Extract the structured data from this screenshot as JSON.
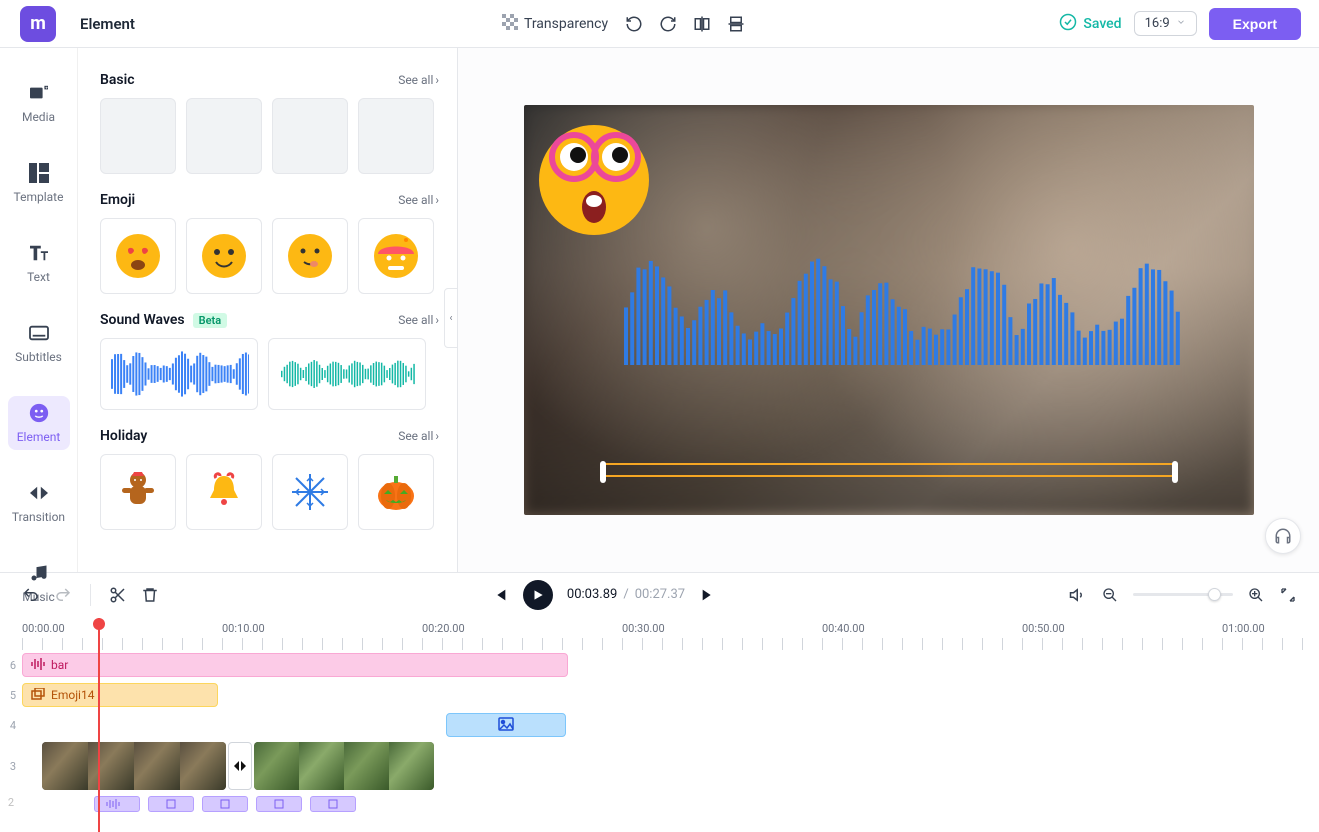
{
  "panel_title": "Element",
  "toolbar": {
    "transparency_label": "Transparency",
    "saved_label": "Saved",
    "ratio_label": "16:9",
    "export_label": "Export"
  },
  "side_rail": [
    {
      "key": "media",
      "label": "Media"
    },
    {
      "key": "template",
      "label": "Template"
    },
    {
      "key": "text",
      "label": "Text"
    },
    {
      "key": "subtitles",
      "label": "Subtitles"
    },
    {
      "key": "element",
      "label": "Element"
    },
    {
      "key": "transition",
      "label": "Transition"
    },
    {
      "key": "music",
      "label": "Music"
    }
  ],
  "see_all": "See all",
  "sections": {
    "basic": {
      "title": "Basic"
    },
    "emoji": {
      "title": "Emoji"
    },
    "sound_waves": {
      "title": "Sound Waves",
      "beta": "Beta"
    },
    "holiday": {
      "title": "Holiday"
    }
  },
  "player": {
    "current_time": "00:03.89",
    "duration": "00:27.37"
  },
  "ruler_marks": [
    "00:00.00",
    "00:10.00",
    "00:20.00",
    "00:30.00",
    "00:40.00",
    "00:50.00",
    "01:00.00"
  ],
  "tracks": {
    "t6": {
      "num": "6",
      "label": "bar"
    },
    "t5": {
      "num": "5",
      "label": "Emoji14"
    },
    "t4": {
      "num": "4"
    },
    "t3": {
      "num": "3"
    },
    "t2": {
      "num": "2"
    }
  }
}
